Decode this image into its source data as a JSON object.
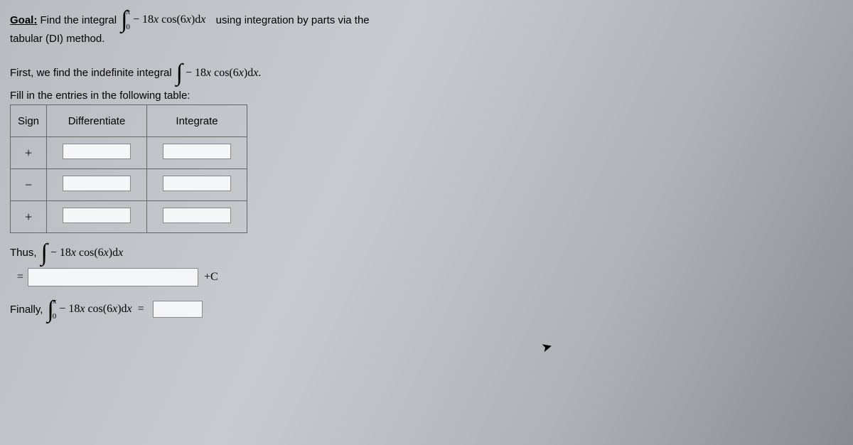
{
  "goal_label": "Goal:",
  "goal_text": "Find the integral",
  "definite_integral": {
    "upper": "π",
    "lower": "0",
    "integrand_prefix": "− 18",
    "integrand_var1": "x",
    "integrand_mid": " cos(6",
    "integrand_var2": "x",
    "integrand_suffix": ")d",
    "integrand_dvar": "x"
  },
  "goal_tail": "using integration by parts via the",
  "goal_line2": "tabular (DI) method.",
  "first_line_a": "First, we find the indefinite integral",
  "indef_integral": {
    "integrand_prefix": "− 18",
    "integrand_var1": "x",
    "integrand_mid": " cos(6",
    "integrand_var2": "x",
    "integrand_suffix": ")d",
    "integrand_dvar": "x",
    "tail": "."
  },
  "fill_line": "Fill in the entries in the following table:",
  "table": {
    "headers": {
      "sign": "Sign",
      "diff": "Differentiate",
      "int": "Integrate"
    },
    "rows": [
      {
        "sign": "+"
      },
      {
        "sign": "−"
      },
      {
        "sign": "+"
      }
    ]
  },
  "thus_label": "Thus,",
  "equals": "=",
  "plus_c": "+C",
  "finally_label": "Finally,",
  "final_eq": "="
}
